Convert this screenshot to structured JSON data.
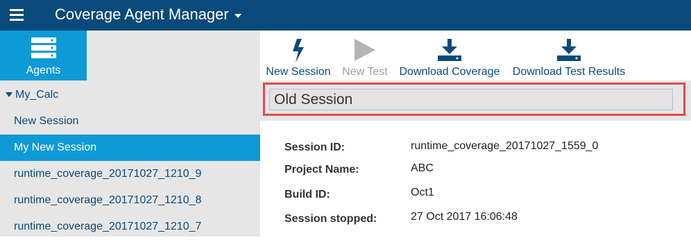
{
  "header": {
    "app_title": "Coverage Agent Manager",
    "menu_icon": "hamburger-menu-icon",
    "title_caret_icon": "caret-down-icon",
    "color": "#0a4a7a"
  },
  "agents_tab": {
    "label": "Agents",
    "icon": "server-stack-icon",
    "color": "#0e9ad6"
  },
  "toolbar": {
    "new_session": "New Session",
    "new_test": "New Test",
    "download_coverage": "Download Coverage",
    "download_test_results": "Download Test Results"
  },
  "sidebar": {
    "group": "My_Calc",
    "items": [
      {
        "label": "New Session",
        "selected": false
      },
      {
        "label": "My New Session",
        "selected": true
      },
      {
        "label": "runtime_coverage_20171027_1210_9",
        "selected": false
      },
      {
        "label": "runtime_coverage_20171027_1210_8",
        "selected": false
      },
      {
        "label": "runtime_coverage_20171027_1210_7",
        "selected": false
      }
    ]
  },
  "session": {
    "title_value": "Old Session",
    "highlight_color": "#e34a4a",
    "details": [
      {
        "label": "Session ID:",
        "value": "runtime_coverage_20171027_1559_0"
      },
      {
        "label": "Project Name:",
        "value": "ABC"
      },
      {
        "label": "Build ID:",
        "value": "Oct1"
      },
      {
        "label": "Session stopped:",
        "value": "27 Oct 2017 16:06:48"
      }
    ]
  }
}
